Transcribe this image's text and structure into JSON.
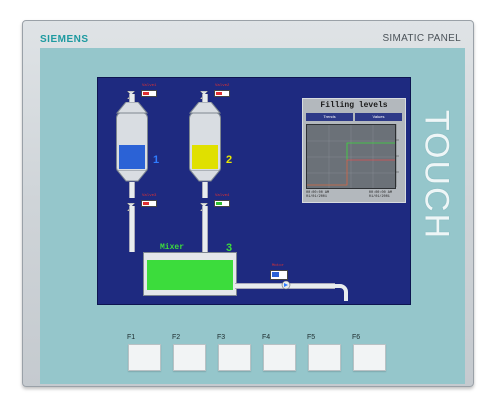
{
  "device": {
    "brand": "SIEMENS",
    "model": "SIMATIC PANEL",
    "side_label": "TOUCH"
  },
  "hmi": {
    "tanks": [
      {
        "valve_top": "Valve1",
        "valve_bottom": "Valve3",
        "number": "1",
        "fill_color": "#2b62d6",
        "fill_fraction": 0.45,
        "number_color": "#2f7cff"
      },
      {
        "valve_top": "Valve2",
        "valve_bottom": "Valve4",
        "number": "2",
        "fill_color": "#e0e000",
        "fill_fraction": 0.45,
        "number_color": "#e8e800"
      }
    ],
    "mixer": {
      "label": "Mixer",
      "number": "3",
      "fill_color": "#3cdc3c",
      "fill_fraction": 0.75
    },
    "motor_label": "Motor",
    "trend": {
      "title": "Filling levels",
      "tabs": [
        "Trends",
        "Values"
      ],
      "footer_left": "00:00:00 AM\n01/01/2001",
      "footer_right": "00:00:00 AM\n01/01/2001"
    }
  },
  "function_keys": [
    "F1",
    "F2",
    "F3",
    "F4",
    "F5",
    "F6"
  ]
}
